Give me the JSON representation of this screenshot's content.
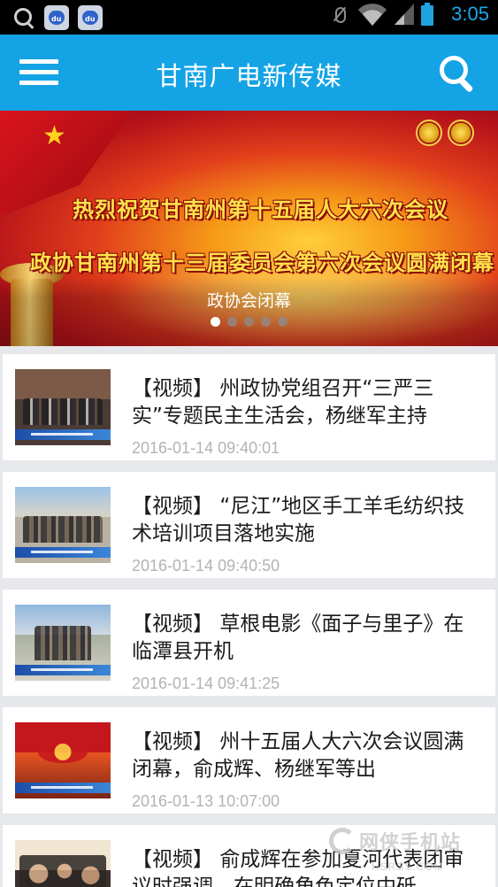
{
  "status_bar": {
    "time": "3:05",
    "time_color": "#1ea8ec",
    "left_icons": [
      "search-icon",
      "baidu-app-icon",
      "baidu-app-icon"
    ],
    "right_icons": [
      "mute-icon",
      "wifi-icon",
      "signal-icon",
      "battery-icon"
    ]
  },
  "app_bar": {
    "title": "甘南广电新传媒",
    "background": "#14a3e4",
    "menu_icon": "hamburger-menu-icon",
    "search_icon": "search-icon"
  },
  "banner": {
    "line1": "热烈祝贺甘南州第十五届人大六次会议",
    "line2": "政协甘南州第十三届委员会第六次会议圆满闭幕",
    "caption": "政协会闭幕",
    "slide_count": 5,
    "active_slide": 1
  },
  "news": [
    {
      "tag": "【视频】",
      "title": "州政协党组召开“三严三实”专题民主生活会，杨继军主持",
      "time": "2016-01-14 09:40:01"
    },
    {
      "tag": "【视频】",
      "title": "“尼江”地区手工羊毛纺织技术培训项目落地实施",
      "time": "2016-01-14 09:40:50"
    },
    {
      "tag": "【视频】",
      "title": "草根电影《面子与里子》在临潭县开机",
      "time": "2016-01-14 09:41:25"
    },
    {
      "tag": "【视频】",
      "title": "州十五届人大六次会议圆满闭幕，俞成辉、杨继军等出",
      "time": "2016-01-13 10:07:00"
    },
    {
      "tag": "【视频】",
      "title": "俞成辉在参加夏河代表团审议时强调，在明确角色定位中砥",
      "time": ""
    }
  ],
  "watermark": {
    "name": "网侠手机站",
    "url": "HSRSS.COM"
  }
}
